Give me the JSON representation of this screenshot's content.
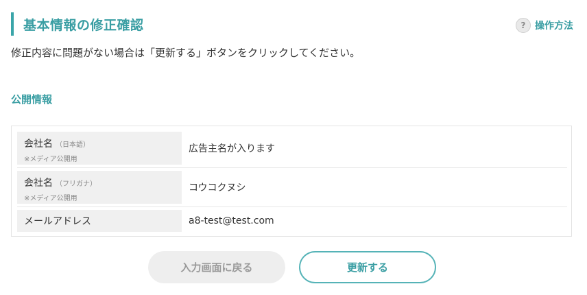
{
  "header": {
    "title": "基本情報の修正確認",
    "help_icon": "question-mark-icon",
    "help_icon_glyph": "?",
    "help_label": "操作方法"
  },
  "intro_text": "修正内容に問題がない場合は「更新する」ボタンをクリックしてください。",
  "section": {
    "title": "公開情報",
    "rows": [
      {
        "label": "会社名",
        "sub": "（日本語）",
        "note": "※メディア公開用",
        "value": "広告主名が入ります"
      },
      {
        "label": "会社名",
        "sub": "（フリガナ）",
        "note": "※メディア公開用",
        "value": "コウコクヌシ"
      },
      {
        "label": "メールアドレス",
        "sub": "",
        "note": "",
        "value": "a8-test@test.com"
      }
    ]
  },
  "buttons": {
    "back_label": "入力画面に戻る",
    "update_label": "更新する"
  },
  "colors": {
    "accent": "#3a9ea3",
    "label_bg": "#f0f0f0",
    "back_button_bg": "#eeeeee"
  }
}
